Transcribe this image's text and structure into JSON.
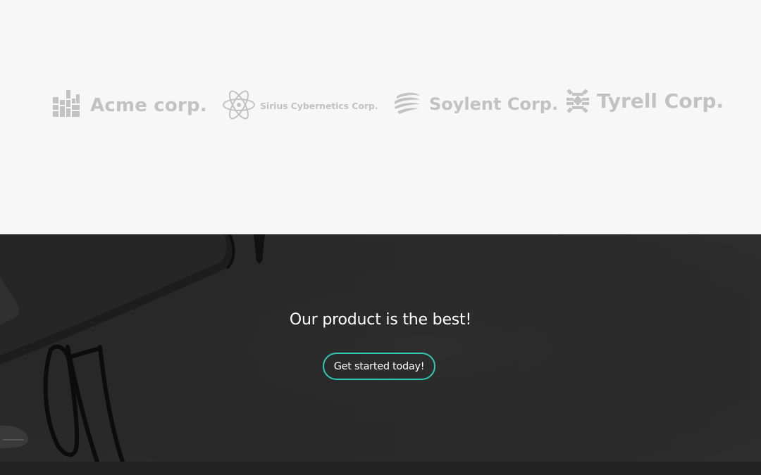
{
  "logos": [
    {
      "name": "Acme corp.",
      "icon": "building-blocks-icon"
    },
    {
      "name": "Sirius Cybernetics Corp.",
      "icon": "atom-icon"
    },
    {
      "name": "Soylent Corp.",
      "icon": "swirl-sphere-icon"
    },
    {
      "name": "Tyrell Corp.",
      "icon": "interlocking-pattern-icon"
    }
  ],
  "cta": {
    "title": "Our product is the best!",
    "button_label": "Get started today!"
  },
  "colors": {
    "logo_gray": "#c2c2c2",
    "light_bg": "#f7f7f7",
    "dark_bg": "#2b2b2b",
    "accent_teal": "#2fc7b6",
    "footer": "#222222"
  }
}
